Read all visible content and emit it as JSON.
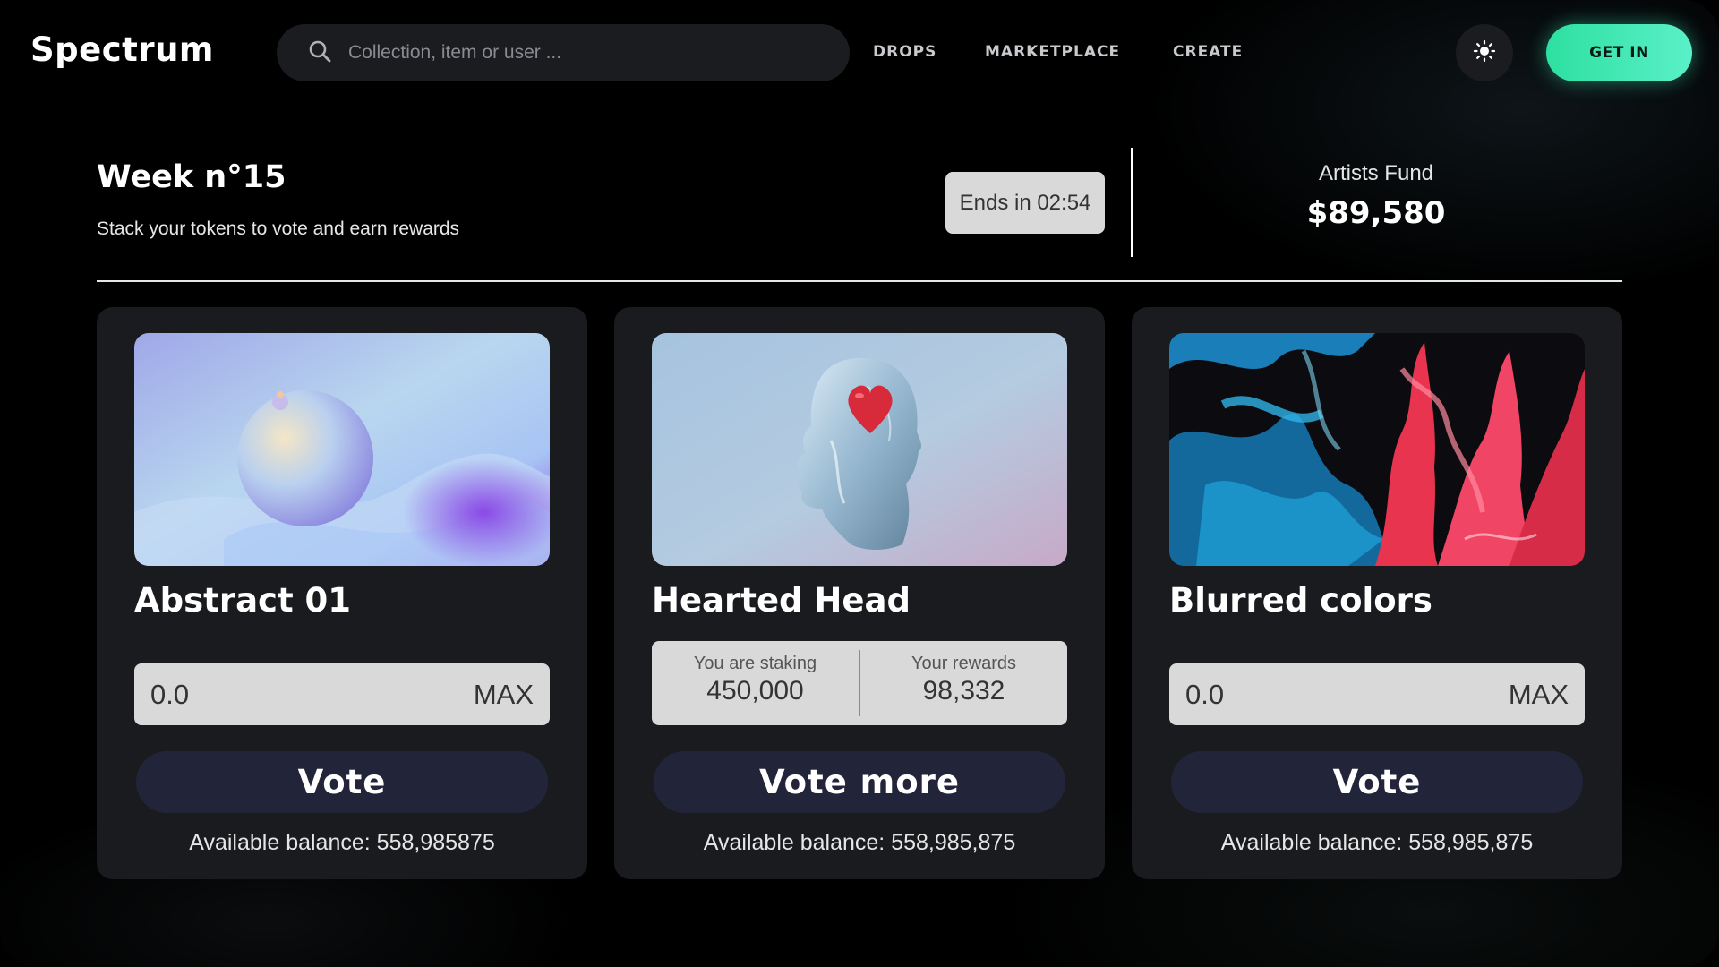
{
  "header": {
    "logo": "Spectrum",
    "search": {
      "placeholder": "Collection, item or user ...",
      "value": ""
    },
    "nav": [
      {
        "label": "DROPS"
      },
      {
        "label": "MARKETPLACE"
      },
      {
        "label": "CREATE"
      }
    ],
    "theme_icon": "sun-icon",
    "cta_label": "GET IN",
    "cta_color": "#2de0a0"
  },
  "week": {
    "title": "Week n°15",
    "subtitle": "Stack your tokens to vote and earn rewards",
    "ends_label": "Ends in 02:54"
  },
  "fund": {
    "label": "Artists Fund",
    "value": "$89,580"
  },
  "cards": [
    {
      "title": "Abstract 01",
      "amount_value": "0.0",
      "max_label": "MAX",
      "button_label": "Vote",
      "balance": "Available balance: 558,985875"
    },
    {
      "title": "Hearted Head",
      "staking_label": "You are staking",
      "staking_value": "450,000",
      "rewards_label": "Your rewards",
      "rewards_value": "98,332",
      "button_label": "Vote more",
      "balance": "Available balance: 558,985,875"
    },
    {
      "title": "Blurred colors",
      "amount_value": "0.0",
      "max_label": "MAX",
      "button_label": "Vote",
      "balance": "Available balance: 558,985,875"
    }
  ]
}
